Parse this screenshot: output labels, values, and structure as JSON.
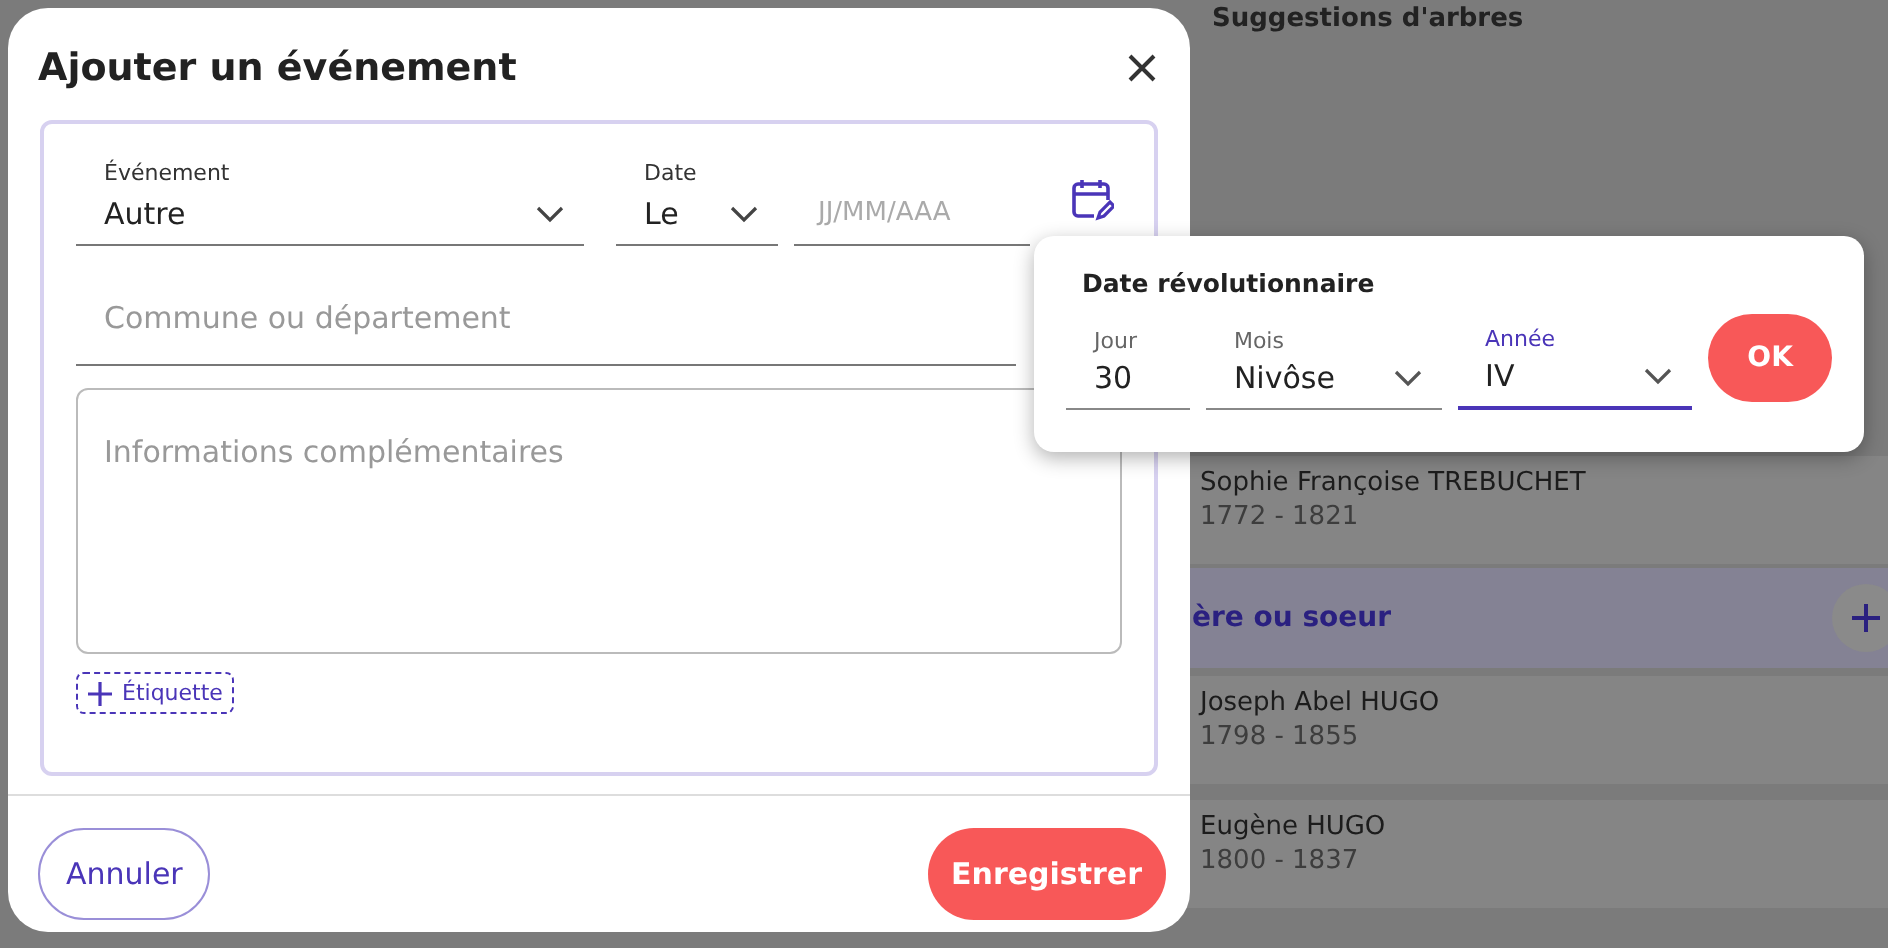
{
  "background": {
    "header": "Suggestions d'arbres",
    "parent": {
      "name": "Sophie Françoise TREBUCHET",
      "years": "1772 - 1821"
    },
    "section_title": "ère ou soeur",
    "siblings": [
      {
        "name": "Joseph Abel HUGO",
        "years": "1798 - 1855"
      },
      {
        "name": "Eugène HUGO",
        "years": "1800 - 1837"
      }
    ]
  },
  "dialog": {
    "title": "Ajouter un événement",
    "event": {
      "label": "Événement",
      "value": "Autre"
    },
    "date": {
      "label": "Date",
      "qualifier": "Le",
      "placeholder": "JJ/MM/AAA"
    },
    "place": {
      "placeholder": "Commune ou département"
    },
    "notes": {
      "placeholder": "Informations complémentaires"
    },
    "tag_button": "Étiquette",
    "cancel": "Annuler",
    "save": "Enregistrer"
  },
  "popover": {
    "title": "Date révolutionnaire",
    "fields": [
      {
        "kind": "text",
        "label": "Jour",
        "value": "30",
        "focused": false
      },
      {
        "kind": "select",
        "label": "Mois",
        "value": "Nivôse",
        "focused": false
      },
      {
        "kind": "select",
        "label": "Année",
        "value": "IV",
        "focused": true
      }
    ],
    "ok": "OK"
  }
}
